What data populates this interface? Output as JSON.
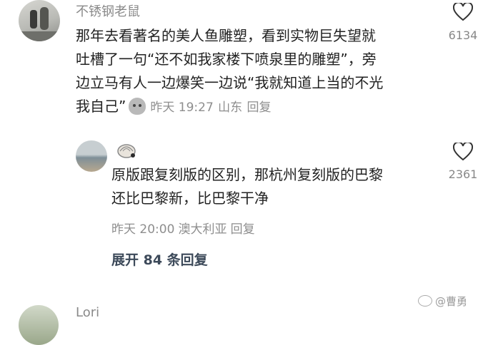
{
  "comments": [
    {
      "username": "不锈钢老鼠",
      "text_lines": [
        "那年去看著名的美人鱼雕塑，看到实物巨失望就",
        "吐槽了一句“还不如我家楼下喷泉里的雕塑”，旁",
        "边立马有人一边爆笑一边说“我就知道上当的不光",
        "我自己”"
      ],
      "time": "昨天 19:27",
      "location": "山东",
      "reply_label": "回复",
      "likes": "6134"
    },
    {
      "username": "",
      "text_lines": [
        "原版跟复刻版的区别，那杭州复刻版的巴黎",
        "还比巴黎新，比巴黎干净"
      ],
      "time": "昨天 20:00",
      "location": "澳大利亚",
      "reply_label": "回复",
      "likes": "2361"
    }
  ],
  "expand_replies": "展开 84 条回复",
  "next_username": "Lori",
  "watermark": "@曹勇"
}
